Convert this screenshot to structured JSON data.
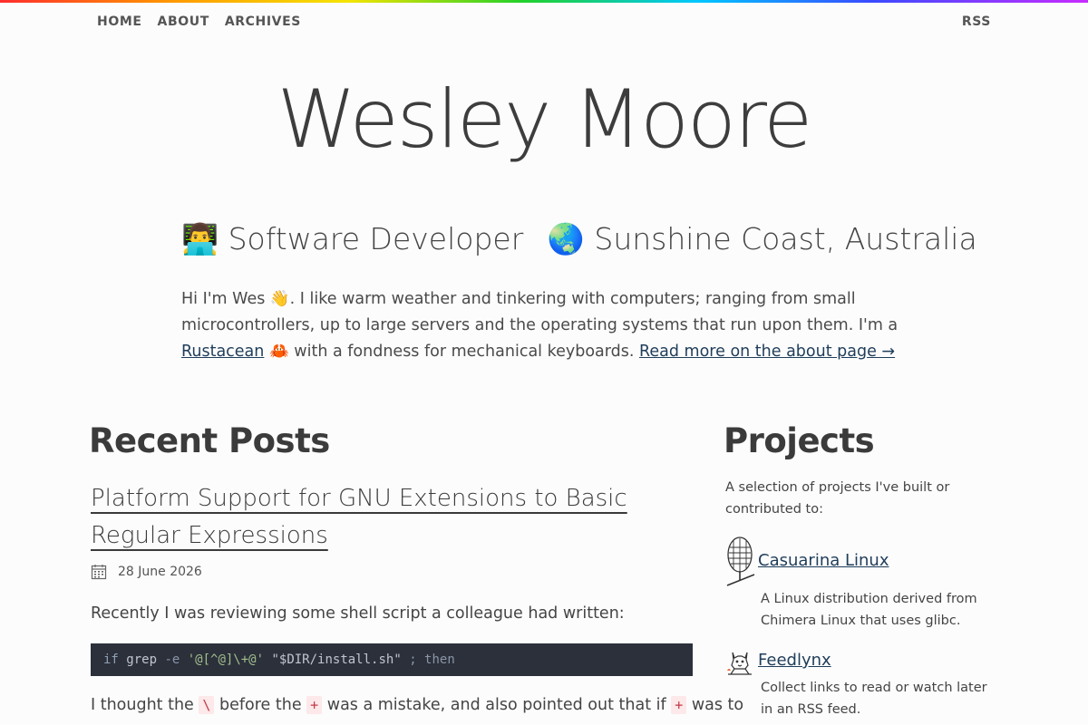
{
  "nav": {
    "home": "HOME",
    "about": "ABOUT",
    "archives": "ARCHIVES",
    "rss": "RSS"
  },
  "site": {
    "title": "Wesley Moore"
  },
  "tagline": {
    "emoji_role": "👨‍💻",
    "role": "Software Developer",
    "emoji_location": "🌏",
    "location": "Sunshine Coast, Australia"
  },
  "intro": {
    "text1": "Hi I'm Wes 👋. I like warm weather and tinkering with computers; ranging from small microcontrollers, up to large servers and the operating systems that run upon them. I'm a ",
    "rustacean_link": "Rustacean",
    "text2": " 🦀 with a fondness for mechanical keyboards. ",
    "about_link": "Read more on the about page →"
  },
  "recent_posts": {
    "heading": "Recent Posts",
    "post": {
      "title": "Platform Support for GNU Extensions to Basic Regular Expressions",
      "date": "28 June 2026",
      "para1": "Recently I was reviewing some shell script a colleague had written:",
      "code": {
        "kw_if": "if",
        "cmd": "grep",
        "flag": " -e ",
        "pattern": "'@[^@]\\+@'",
        "space": " ",
        "path": "\"$DIR/install.sh\"",
        "tail": " ; then"
      },
      "para2_a": "I thought the ",
      "para2_code1": "\\",
      "para2_b": " before the ",
      "para2_code2": "+",
      "para2_c": " was a mistake, and also pointed out that if ",
      "para2_code3": "+",
      "para2_d": " was to"
    }
  },
  "projects": {
    "heading": "Projects",
    "description": "A selection of projects I've built or contributed to:",
    "items": [
      {
        "name": "Casuarina Linux",
        "icon": "casuarina-cone-icon",
        "description": "A Linux distribution derived from Chimera Linux that uses glibc."
      },
      {
        "name": "Feedlynx",
        "icon": "lynx-icon",
        "description": "Collect links to read or watch later in an RSS feed."
      }
    ]
  }
}
